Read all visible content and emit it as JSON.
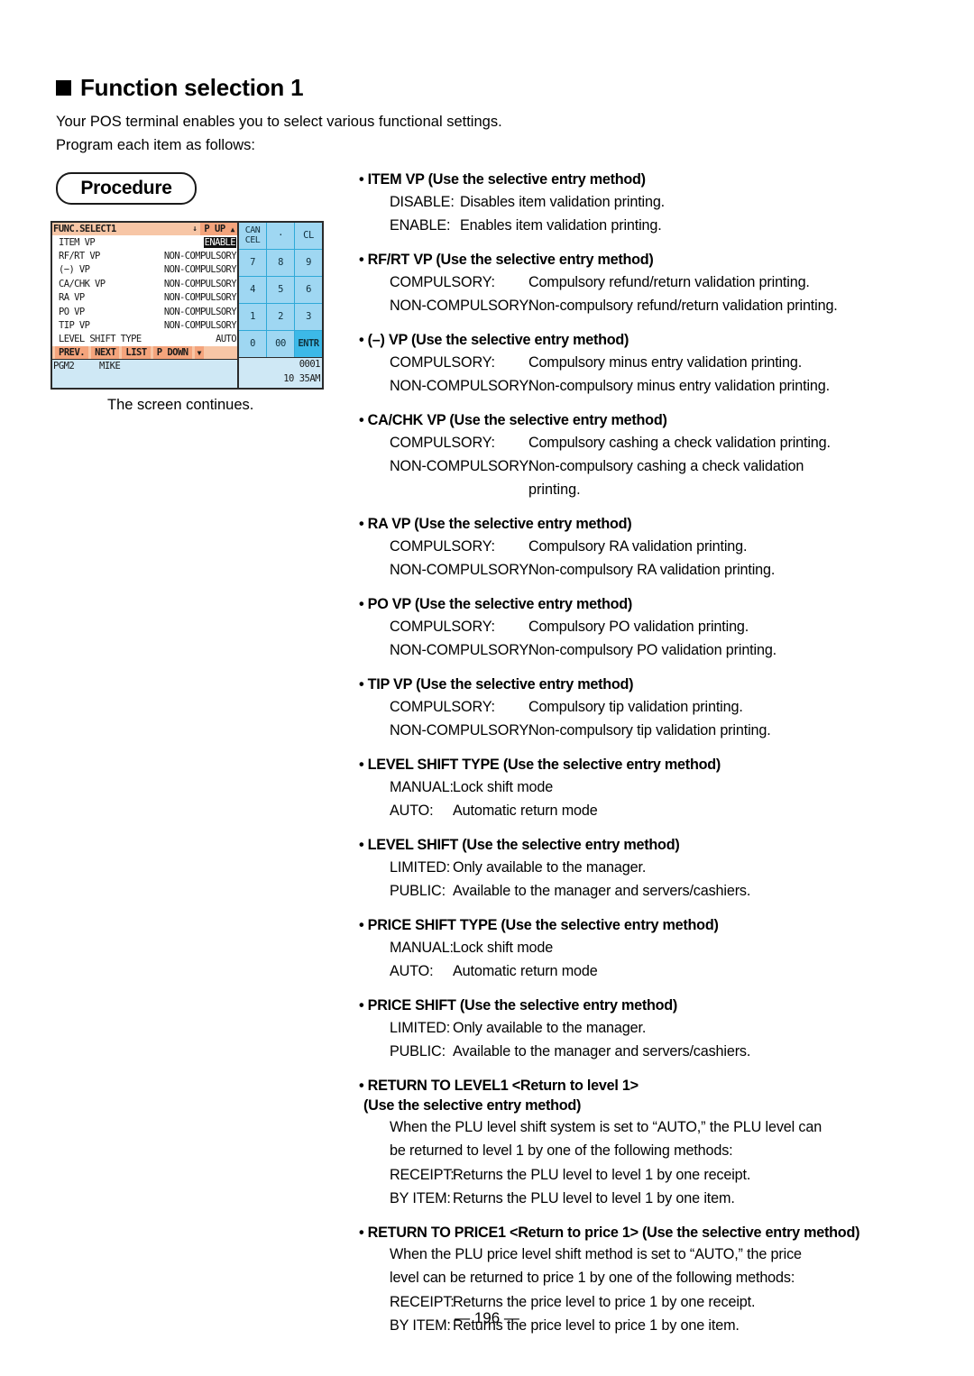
{
  "heading": {
    "title": "Function selection 1",
    "intro_line1": "Your POS terminal enables you to select various functional settings.",
    "intro_line2": "Program each item as follows:"
  },
  "procedure": {
    "badge_label": "Procedure",
    "caption": "The screen continues."
  },
  "pos_screen": {
    "titlebar": {
      "title": "FUNC.SELECT1",
      "arrow_down": "↓",
      "page_up": "P UP",
      "arrow_up": "▲"
    },
    "rows": [
      {
        "label": "ITEM VP",
        "value": "ENABLE",
        "inverted": true
      },
      {
        "label": "RF/RT VP",
        "value": "NON-COMPULSORY",
        "inverted": false
      },
      {
        "label": "(−) VP",
        "value": "NON-COMPULSORY",
        "inverted": false
      },
      {
        "label": "CA/CHK VP",
        "value": "NON-COMPULSORY",
        "inverted": false
      },
      {
        "label": "RA VP",
        "value": "NON-COMPULSORY",
        "inverted": false
      },
      {
        "label": "PO VP",
        "value": "NON-COMPULSORY",
        "inverted": false
      },
      {
        "label": "TIP VP",
        "value": "NON-COMPULSORY",
        "inverted": false
      },
      {
        "label": "LEVEL SHIFT TYPE",
        "value": "AUTO",
        "inverted": false
      }
    ],
    "navbar": {
      "prev": "PREV.",
      "next": "NEXT",
      "list": "LIST",
      "page_down": "P DOWN",
      "arrow_down": "▼"
    },
    "status": {
      "mode": "PGM2",
      "user": "MIKE",
      "number": "0001",
      "time": "10 35AM"
    },
    "keypad": [
      {
        "label": "CANCEL",
        "name": "cancel-key",
        "style": "cancel"
      },
      {
        "label": "·",
        "name": "decimal-key",
        "style": "normal"
      },
      {
        "label": "CL",
        "name": "clear-key",
        "style": "normal"
      },
      {
        "label": "7",
        "name": "key-7",
        "style": "normal"
      },
      {
        "label": "8",
        "name": "key-8",
        "style": "normal"
      },
      {
        "label": "9",
        "name": "key-9",
        "style": "normal"
      },
      {
        "label": "4",
        "name": "key-4",
        "style": "normal"
      },
      {
        "label": "5",
        "name": "key-5",
        "style": "normal"
      },
      {
        "label": "6",
        "name": "key-6",
        "style": "normal"
      },
      {
        "label": "1",
        "name": "key-1",
        "style": "normal"
      },
      {
        "label": "2",
        "name": "key-2",
        "style": "normal"
      },
      {
        "label": "3",
        "name": "key-3",
        "style": "normal"
      },
      {
        "label": "0",
        "name": "key-0",
        "style": "normal"
      },
      {
        "label": "00",
        "name": "key-00",
        "style": "normal"
      },
      {
        "label": "ENTR",
        "name": "enter-key",
        "style": "hl"
      }
    ],
    "colors": {
      "titlebar": "#f7c6a6",
      "navbar_cell": "#f4a47c",
      "key": "#9fd7f2",
      "key_highlight": "#3cb9e8",
      "status_bar": "#cfe8f5"
    }
  },
  "blocks": [
    {
      "title": "• ITEM VP (Use the selective entry method)",
      "width": "narrow",
      "defs": [
        {
          "term": "DISABLE:",
          "desc": "Disables item validation printing."
        },
        {
          "term": "ENABLE:",
          "desc": "Enables item validation printing."
        }
      ]
    },
    {
      "title": "• RF/RT VP (Use the selective entry method)",
      "width": "wide",
      "defs": [
        {
          "term": "COMPULSORY:",
          "desc": "Compulsory refund/return validation printing."
        },
        {
          "term": "NON-COMPULSORY:",
          "desc": "Non-compulsory refund/return validation printing."
        }
      ]
    },
    {
      "title": "• (–) VP (Use the selective entry method)",
      "width": "wide",
      "defs": [
        {
          "term": "COMPULSORY:",
          "desc": "Compulsory minus entry validation printing."
        },
        {
          "term": "NON-COMPULSORY:",
          "desc": "Non-compulsory minus entry validation printing."
        }
      ]
    },
    {
      "title": "• CA/CHK VP (Use the selective entry method)",
      "width": "wide",
      "defs": [
        {
          "term": "COMPULSORY:",
          "desc": "Compulsory cashing a check validation printing."
        },
        {
          "term": "NON-COMPULSORY:",
          "desc": "Non-compulsory cashing a check validation"
        }
      ],
      "continuation": "printing."
    },
    {
      "title": "• RA VP (Use the selective entry method)",
      "width": "wide",
      "defs": [
        {
          "term": "COMPULSORY:",
          "desc": "Compulsory RA validation printing."
        },
        {
          "term": "NON-COMPULSORY:",
          "desc": "Non-compulsory RA validation printing."
        }
      ]
    },
    {
      "title": "• PO VP (Use the selective entry method)",
      "width": "wide",
      "defs": [
        {
          "term": "COMPULSORY:",
          "desc": "Compulsory PO validation printing."
        },
        {
          "term": "NON-COMPULSORY:",
          "desc": "Non-compulsory PO validation printing."
        }
      ]
    },
    {
      "title": "• TIP VP (Use the selective entry method)",
      "width": "wide",
      "defs": [
        {
          "term": "COMPULSORY:",
          "desc": "Compulsory tip validation printing."
        },
        {
          "term": "NON-COMPULSORY:",
          "desc": "Non-compulsory tip validation printing."
        }
      ]
    },
    {
      "title": "• LEVEL SHIFT TYPE (Use the selective entry method)",
      "width": "mid",
      "defs": [
        {
          "term": "MANUAL:",
          "desc": "Lock shift mode"
        },
        {
          "term": "AUTO:",
          "desc": "Automatic return mode"
        }
      ]
    },
    {
      "title": "• LEVEL SHIFT (Use the selective entry method)",
      "width": "mid",
      "defs": [
        {
          "term": "LIMITED:",
          "desc": "Only available to the manager."
        },
        {
          "term": "PUBLIC:",
          "desc": "Available to the manager and servers/cashiers."
        }
      ]
    },
    {
      "title": "• PRICE SHIFT TYPE (Use the selective entry method)",
      "width": "mid",
      "defs": [
        {
          "term": "MANUAL:",
          "desc": "Lock shift mode"
        },
        {
          "term": "AUTO:",
          "desc": "Automatic return mode"
        }
      ]
    },
    {
      "title": "• PRICE SHIFT (Use the selective entry method)",
      "width": "mid",
      "defs": [
        {
          "term": "LIMITED:",
          "desc": "Only available to the manager."
        },
        {
          "term": "PUBLIC:",
          "desc": "Available to the manager and servers/cashiers."
        }
      ]
    },
    {
      "title": "• RETURN TO LEVEL1 <Return to level 1>",
      "subtitle": "(Use the selective entry method)",
      "width": "mid",
      "paragraph_lines": [
        "When the PLU level shift system is set to “AUTO,” the PLU level can",
        "be returned to level 1 by one of the following methods:"
      ],
      "defs": [
        {
          "term": "RECEIPT:",
          "desc": "Returns the PLU level to level 1 by one receipt."
        },
        {
          "term": "BY ITEM:",
          "desc": "Returns the PLU level to level 1 by one item."
        }
      ]
    },
    {
      "title": "• RETURN TO PRICE1 <Return to price 1> (Use the selective entry method)",
      "width": "mid",
      "paragraph_lines": [
        "When the PLU price level shift method is set to “AUTO,” the price",
        "level can be returned to price 1 by one of the following methods:"
      ],
      "defs": [
        {
          "term": "RECEIPT:",
          "desc": "Returns the price level to price 1 by one receipt."
        },
        {
          "term": "BY ITEM:",
          "desc": "Returns the price level to price 1 by one item."
        }
      ]
    }
  ],
  "footer": {
    "page_number": "— 196 —"
  }
}
